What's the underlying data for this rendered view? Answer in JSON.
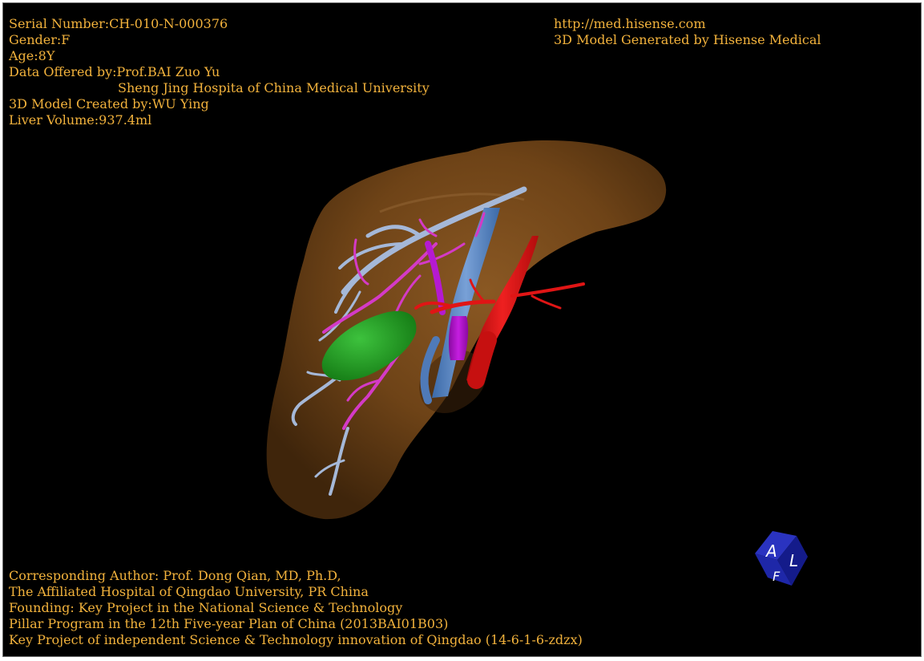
{
  "header_left": {
    "serial": "Serial Number:CH-010-N-000376",
    "gender": "Gender:F",
    "age": "Age:8Y",
    "data_offered": "Data Offered by:Prof.BAI Zuo Yu",
    "hospital": "Sheng Jing Hospita of China Medical University",
    "model_created": "3D Model Created by:WU Ying",
    "liver_volume": "Liver Volume:937.4ml"
  },
  "header_right": {
    "url": "http://med.hisense.com",
    "generator": "3D Model Generated by Hisense Medical"
  },
  "footer": {
    "line1": "Corresponding Author: Prof. Dong Qian, MD, Ph.D,",
    "line2": "The Affiliated Hospital of Qingdao University, PR China",
    "line3": "Founding: Key Project in the National Science & Technology",
    "line4": "Pillar Program in the 12th Five-year Plan of China (2013BAI01B03)",
    "line5": "Key Project of independent Science & Technology innovation of Qingdao (14-6-1-6-zdzx)"
  },
  "orientation_cube": {
    "face_top_left": "A",
    "face_top_right": "L",
    "face_bottom": "F",
    "color": "#1a22a0"
  },
  "colors": {
    "text": "#f2b23c",
    "background": "#000000",
    "liver": "#6e4317",
    "artery": "#e01515",
    "portal_vein": "#5b86c0",
    "hepatic_vein": "#a5b8d8",
    "bile_duct": "#d43ac6",
    "gallbladder": "#1f9a1f"
  }
}
